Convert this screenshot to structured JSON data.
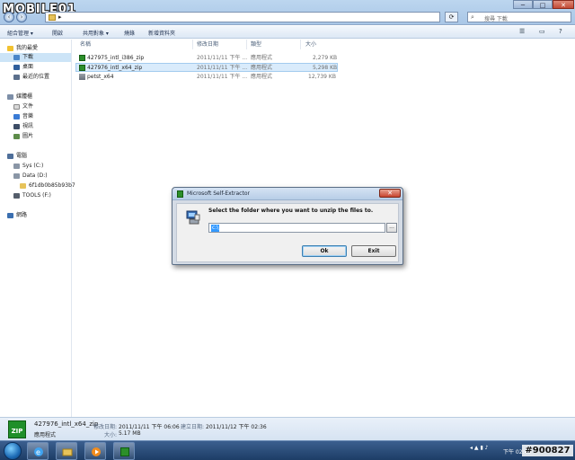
{
  "watermark": {
    "logo": "MOBILE01",
    "stamp": "#900827"
  },
  "window": {
    "controls": {
      "minimize": "─",
      "maximize": "□",
      "close": "✕"
    },
    "search_placeholder": "搜尋 下載"
  },
  "toolbar": {
    "items": [
      "組合管理 ▾",
      "開啟",
      "共用對象 ▾",
      "燒錄",
      "新增資料夾"
    ],
    "right_icons": [
      "view-icon",
      "preview-pane-icon",
      "help-icon"
    ]
  },
  "sidebar": {
    "favorites_header": "我的最愛",
    "favorites": [
      "下載",
      "桌面",
      "最近的位置"
    ],
    "libraries_header": "媒體櫃",
    "libraries": [
      "文件",
      "音樂",
      "視訊",
      "圖片"
    ],
    "computer_header": "電腦",
    "drives": [
      "Sys (C:)",
      "Data (D:)",
      "6f1db0b85b93b7",
      "TOOLS (F:)"
    ],
    "network": "網路"
  },
  "files": {
    "columns": [
      "名稱",
      "修改日期",
      "類型",
      "大小"
    ],
    "rows": [
      {
        "name": "427975_intl_i386_zip",
        "date": "2011/11/11 下午 ...",
        "type": "應用程式",
        "size": "2,279 KB",
        "icon": "zip-icon",
        "selected": false
      },
      {
        "name": "427976_intl_x64_zip",
        "date": "2011/11/11 下午 ...",
        "type": "應用程式",
        "size": "5,298 KB",
        "icon": "zip-icon",
        "selected": true
      },
      {
        "name": "petst_x64",
        "date": "2011/11/11 下午 ...",
        "type": "應用程式",
        "size": "12,739 KB",
        "icon": "folder-icon",
        "selected": false
      }
    ]
  },
  "details": {
    "filename": "427976_intl_x64_zip",
    "type": "應用程式",
    "modified_label": "修改日期:",
    "modified": "2011/11/11 下午 06:06",
    "created_label": "建立日期:",
    "created": "2011/11/12 下午 02:36",
    "size_label": "大小:",
    "size": "5.17 MB",
    "icon_text": "ZIP"
  },
  "dialog": {
    "title": "Microsoft Self-Extractor",
    "close": "✕",
    "message": "Select the folder where you want to unzip the files to.",
    "path_value": "c:\\",
    "browse": "...",
    "ok": "Ok",
    "exit": "Exit"
  },
  "taskbar": {
    "apps": [
      "ie-icon",
      "explorer-icon",
      "media-player-icon",
      "zip-extractor-icon"
    ],
    "clock": "下午 02:43"
  }
}
